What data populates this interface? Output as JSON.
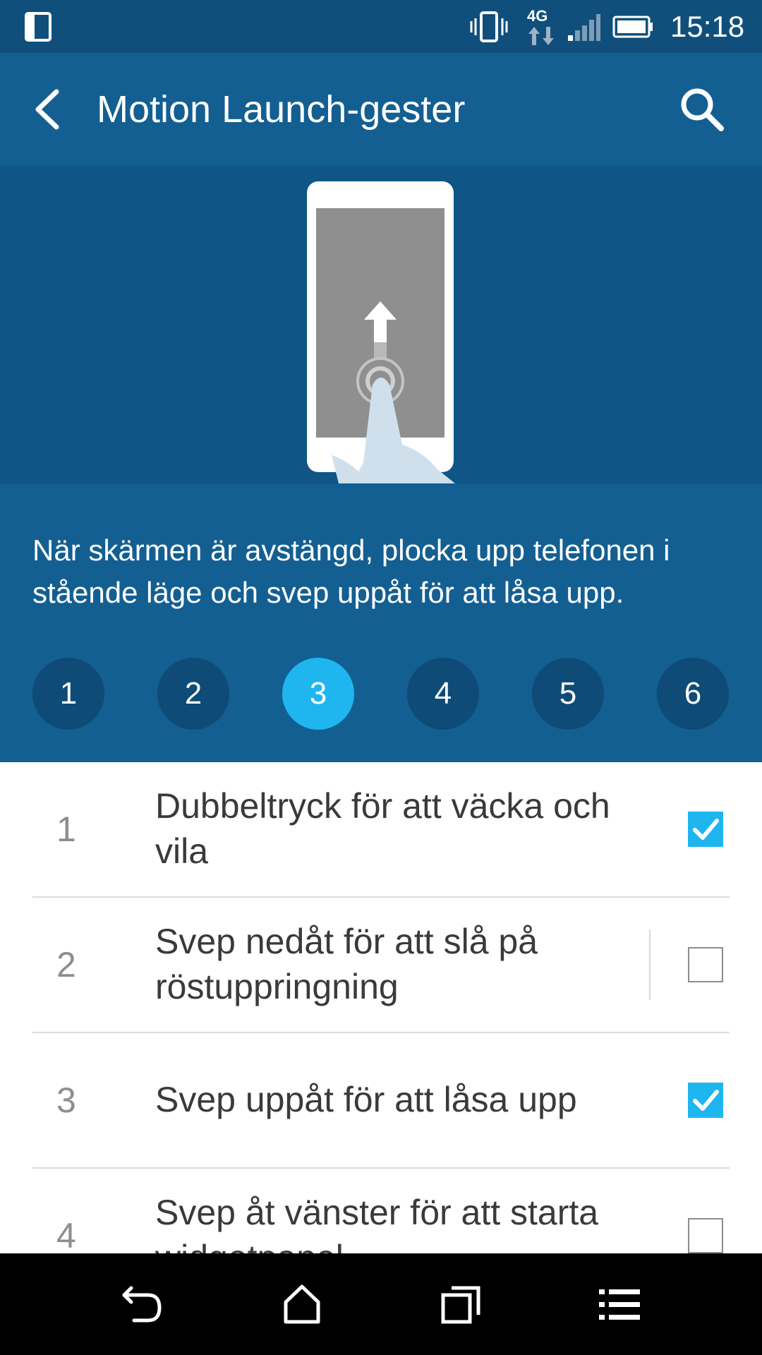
{
  "status_bar": {
    "time": "15:18",
    "network_type": "4G",
    "icons": [
      "tablet-icon",
      "vibrate-icon",
      "4g-data-icon",
      "signal-icon",
      "battery-icon"
    ]
  },
  "app_bar": {
    "title": "Motion Launch-gester",
    "back_icon": "back-arrow-icon",
    "search_icon": "search-icon"
  },
  "illustration": {
    "description_icon": "phone-swipe-up-illustration"
  },
  "description": "När skärmen är avstängd, plocka upp telefonen i stående läge och svep uppåt för att låsa upp.",
  "steps": {
    "items": [
      "1",
      "2",
      "3",
      "4",
      "5",
      "6"
    ],
    "active": "3"
  },
  "gestures": [
    {
      "number": "1",
      "label": "Dubbeltryck för att väcka och vila",
      "checked": true
    },
    {
      "number": "2",
      "label": "Svep nedåt för att slå på röstuppringning",
      "checked": false
    },
    {
      "number": "3",
      "label": "Svep uppåt för att låsa upp",
      "checked": true
    },
    {
      "number": "4",
      "label": "Svep åt vänster för att starta widgetpanel",
      "checked": false
    }
  ],
  "nav_bar": {
    "icons": [
      "back-icon",
      "home-icon",
      "recents-icon",
      "menu-icon"
    ]
  },
  "colors": {
    "status_bar": "#104f7c",
    "app_bar": "#135f92",
    "illustration_bg": "#0f5585",
    "accent": "#1fb6f0",
    "step_inactive": "#0e4b76"
  }
}
